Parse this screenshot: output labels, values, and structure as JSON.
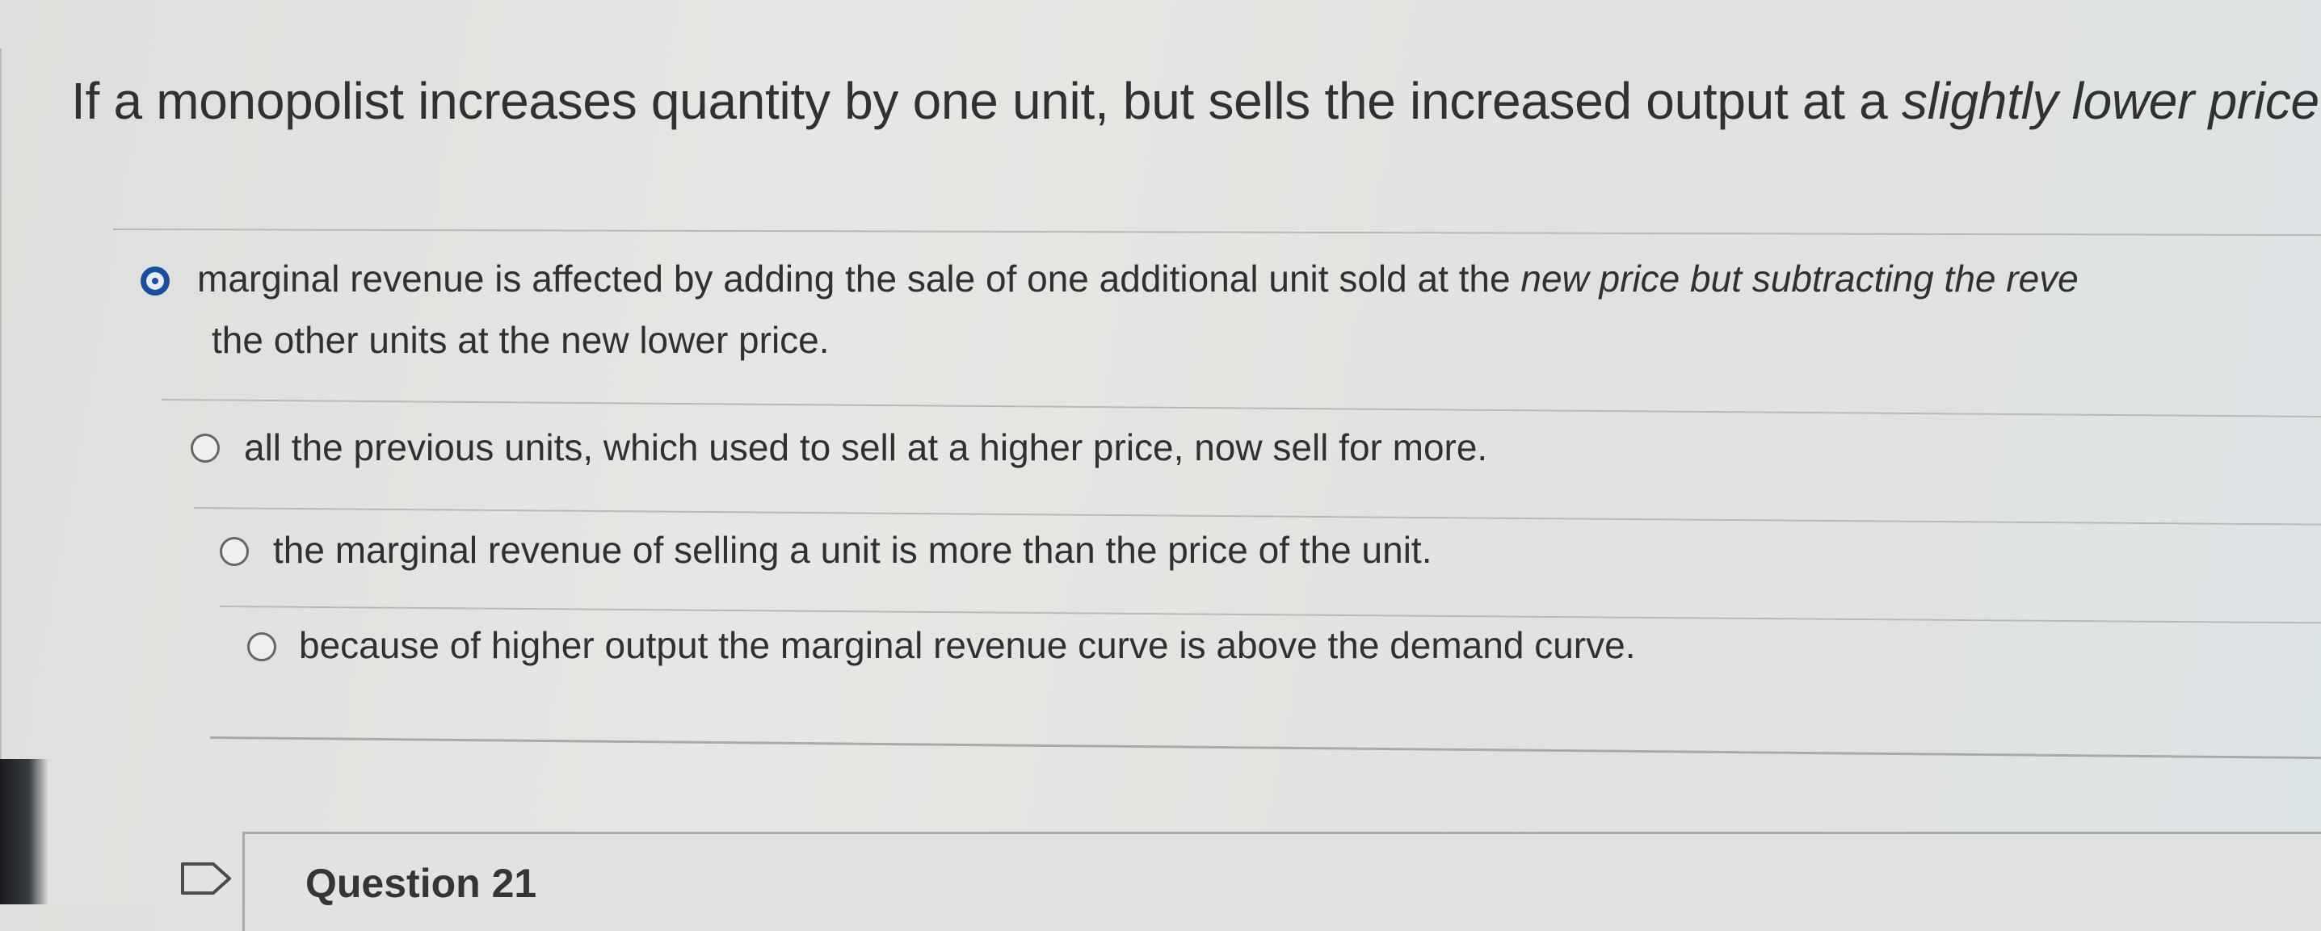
{
  "question": {
    "prompt_plain": "If a monopolist increases quantity by one unit, but sells the increased output at a ",
    "prompt_italic": "slightly lower price",
    "prompt_end": ",,"
  },
  "choices": [
    {
      "line1_plain": "marginal revenue is affected by adding the sale of one additional unit sold at the ",
      "line1_italic": "new price but subtracting the reve",
      "line2": "the other units at the new lower price.",
      "selected": true
    },
    {
      "text": "all the previous units, which used to sell at a higher price, now sell for more.",
      "selected": false
    },
    {
      "text": "the marginal revenue of selling a unit is more than the price of the unit.",
      "selected": false
    },
    {
      "text": "because of higher output the marginal revenue curve is above the demand curve.",
      "selected": false
    }
  ],
  "next_question": {
    "label": "Question 21",
    "icon": "flag-icon"
  },
  "colors": {
    "selected_radio": "#1a4fa0",
    "text": "#2e3032"
  }
}
